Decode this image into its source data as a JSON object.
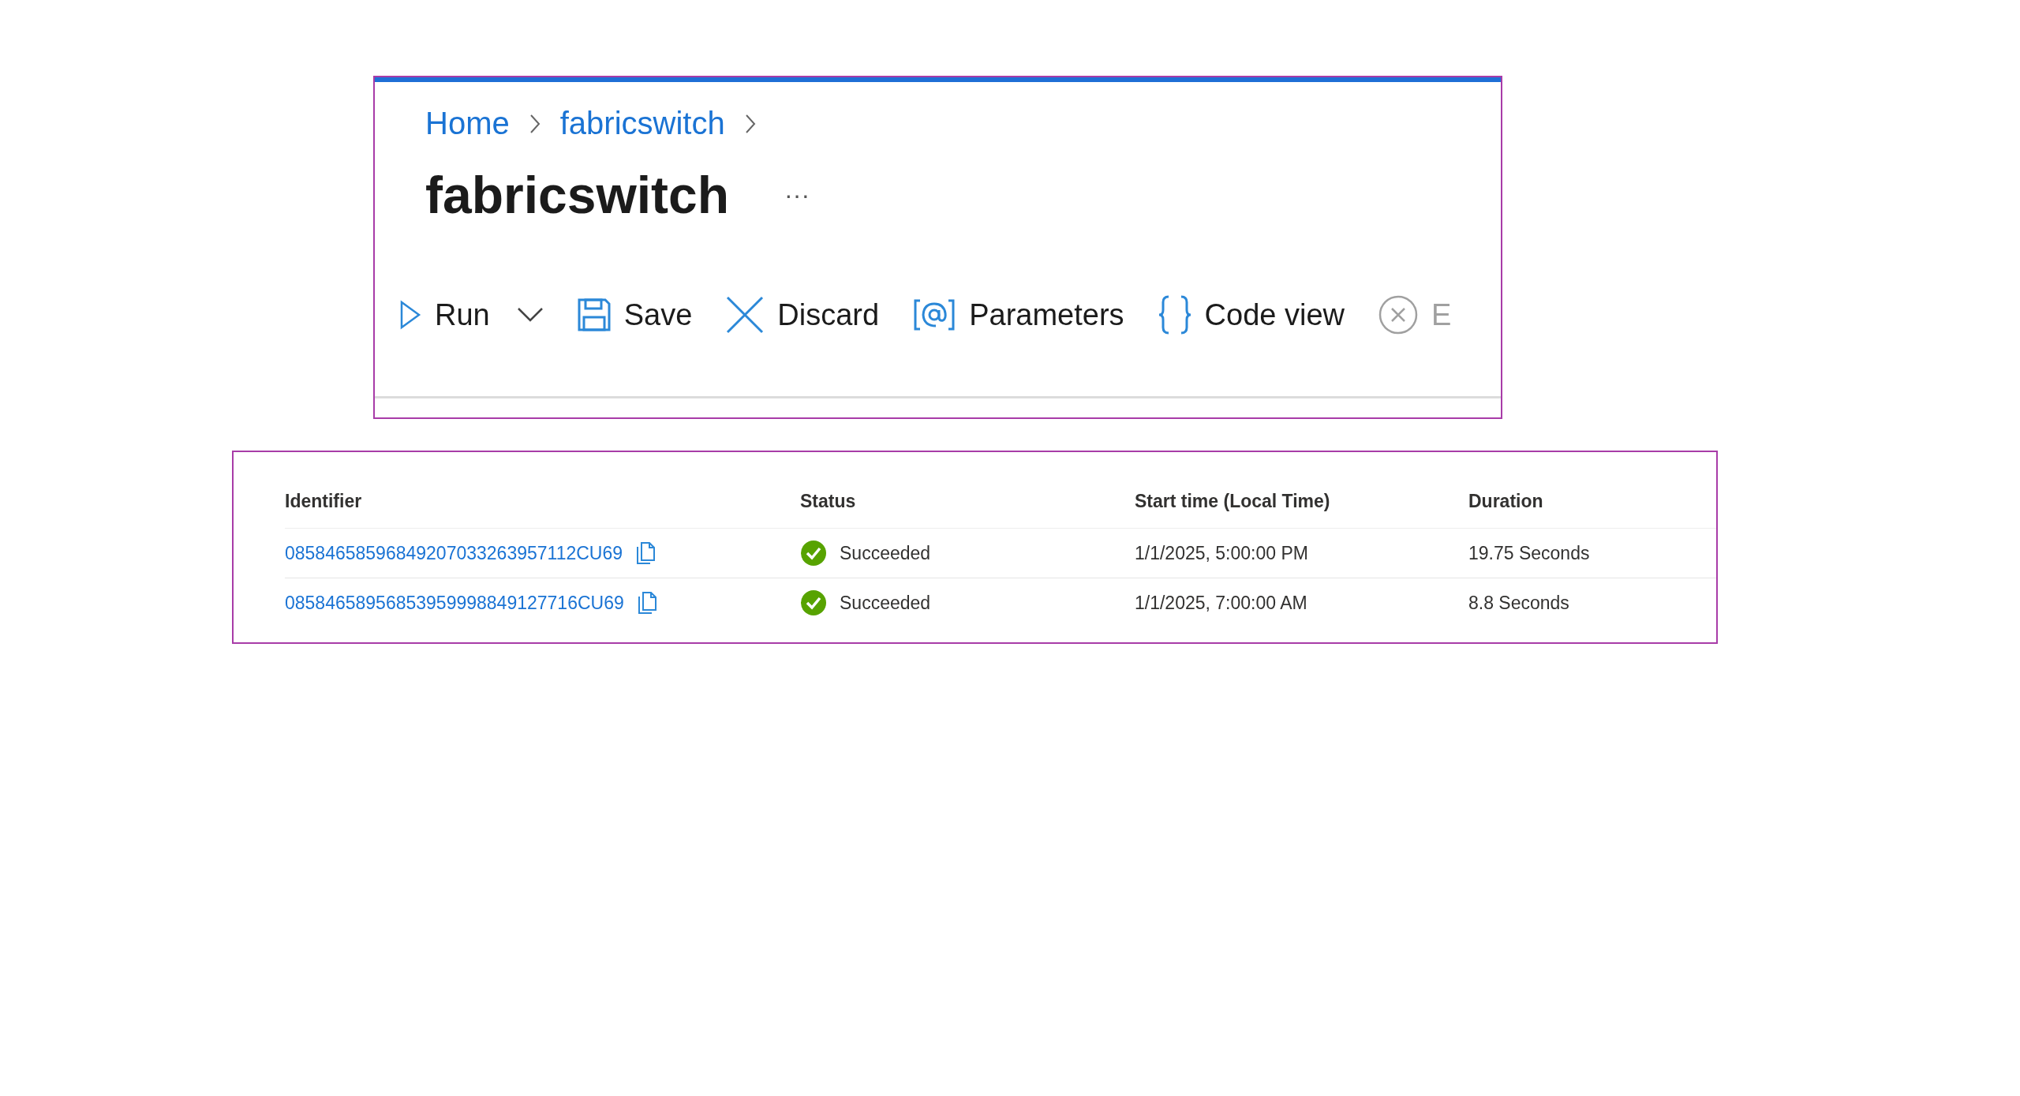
{
  "breadcrumb": [
    {
      "label": "Home"
    },
    {
      "label": "fabricswitch"
    }
  ],
  "title": "fabricswitch",
  "more_button": "···",
  "toolbar": [
    {
      "kind": "run",
      "label": "Run",
      "disabled": false
    },
    {
      "kind": "save",
      "label": "Save",
      "disabled": false
    },
    {
      "kind": "discard",
      "label": "Discard",
      "disabled": false
    },
    {
      "kind": "parameters",
      "label": "Parameters",
      "disabled": false
    },
    {
      "kind": "code",
      "label": "Code view",
      "disabled": false
    },
    {
      "kind": "error",
      "label": "E",
      "disabled": true
    }
  ],
  "table": {
    "columns": [
      "Identifier",
      "Status",
      "Start time (Local Time)",
      "Duration"
    ],
    "rows": [
      {
        "identifier": "08584658596849207033263957112CU69",
        "status": "Succeeded",
        "start_time": "1/1/2025, 5:00:00 PM",
        "duration": "19.75 Seconds"
      },
      {
        "identifier": "08584658956853959998849127716CU69",
        "status": "Succeeded",
        "start_time": "1/1/2025, 7:00:00 AM",
        "duration": "8.8 Seconds"
      }
    ]
  }
}
